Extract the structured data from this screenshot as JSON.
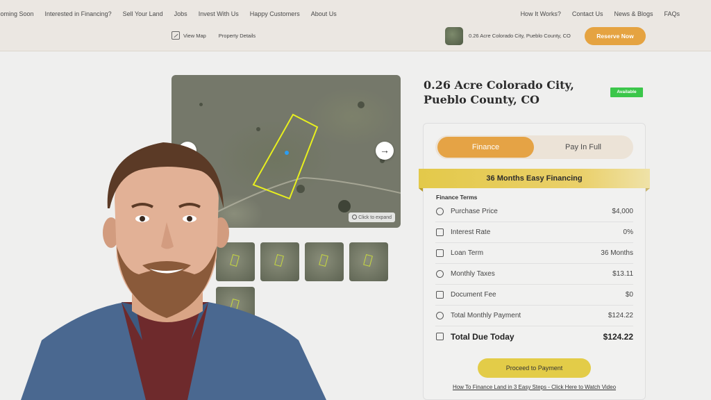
{
  "nav": {
    "left": [
      "Coming Soon",
      "Interested in Financing?",
      "Sell Your Land",
      "Jobs",
      "Invest With Us",
      "Happy Customers",
      "About Us"
    ],
    "right": [
      "How It Works?",
      "Contact Us",
      "News & Blogs",
      "FAQs"
    ]
  },
  "subnav": {
    "view_map": "View Map",
    "property_details": "Property Details"
  },
  "header_property": {
    "title": "0.26 Acre Colorado City, Pueblo County, CO",
    "reserve": "Reserve Now"
  },
  "gallery": {
    "expand_label": "Click to expand",
    "next_arrow": "→",
    "prev_arrow": "←"
  },
  "property": {
    "title": "0.26 Acre Colorado City, Pueblo County, CO",
    "status": "Available"
  },
  "payment_toggle": {
    "finance": "Finance",
    "pay_in_full": "Pay In Full",
    "active": "finance"
  },
  "financing_banner": "36 Months Easy Financing",
  "terms": {
    "heading": "Finance Terms",
    "rows": [
      {
        "icon": "dollar-icon",
        "label": "Purchase Price",
        "value": "$4,000"
      },
      {
        "icon": "chart-icon",
        "label": "Interest Rate",
        "value": "0%"
      },
      {
        "icon": "calendar-icon",
        "label": "Loan Term",
        "value": "36 Months"
      },
      {
        "icon": "tax-icon",
        "label": "Monthly Taxes",
        "value": "$13.11"
      },
      {
        "icon": "document-icon",
        "label": "Document Fee",
        "value": "$0"
      },
      {
        "icon": "dollar-icon",
        "label": "Total Monthly Payment",
        "value": "$124.22"
      }
    ],
    "total": {
      "icon": "receipt-icon",
      "label": "Total Due Today",
      "value": "$124.22"
    }
  },
  "actions": {
    "proceed": "Proceed to Payment",
    "video_link": "How To Finance Land in 3 Easy Steps - Click Here to Watch Video"
  },
  "colors": {
    "accent": "#e5a341",
    "available": "#3bc64a",
    "banner": "#e3c94a",
    "parcel_outline": "#e8f01e"
  }
}
